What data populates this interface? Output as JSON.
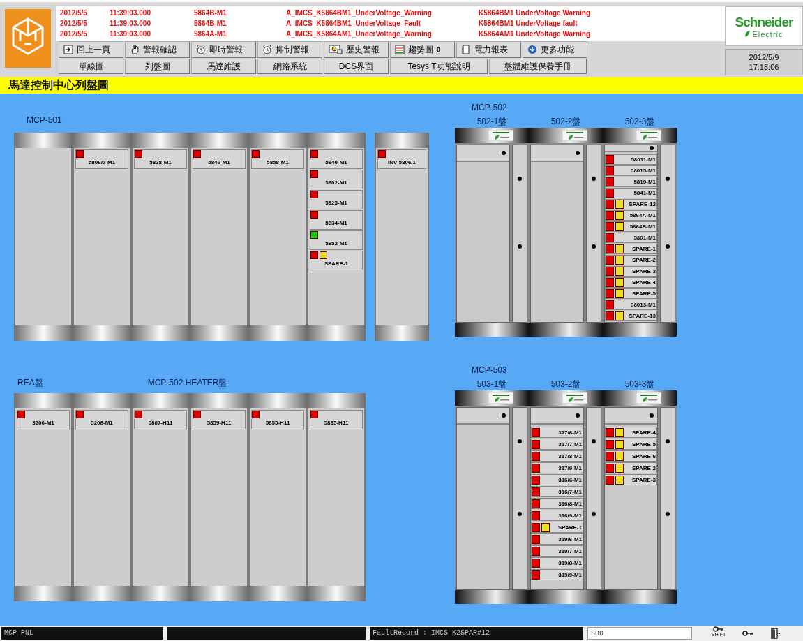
{
  "header": {
    "alarms": [
      {
        "date": "2012/5/5",
        "time": "11:39:03.000",
        "tag": "5864B-M1",
        "code": "A_IMCS_K5864BM1_UnderVoltage_Warning",
        "message": "K5864BM1 UnderVoltage Warning"
      },
      {
        "date": "2012/5/5",
        "time": "11:39:03.000",
        "tag": "5864B-M1",
        "code": "A_IMCS_K5864BM1_UnderVoltage_Fault",
        "message": "K5864BM1 UnderVoltage fault"
      },
      {
        "date": "2012/5/5",
        "time": "11:39:03.000",
        "tag": "5864A-M1",
        "code": "A_IMCS_K5864AM1_UnderVoltage_Warning",
        "message": "K5864AM1 UnderVoltage Warning"
      }
    ],
    "toolbar": [
      {
        "label": "回上一頁",
        "kind": "back"
      },
      {
        "label": "警報確認",
        "kind": "hand"
      },
      {
        "label": "即時警報",
        "kind": "alarm"
      },
      {
        "label": "抑制警報",
        "kind": "alarm"
      },
      {
        "label": "歷史警報",
        "kind": "history"
      },
      {
        "label": "趨勢圖",
        "kind": "trend",
        "count": "0"
      },
      {
        "label": "電力報表",
        "kind": "report"
      },
      {
        "label": "更多功能",
        "kind": "more"
      }
    ],
    "nav": [
      "單線圖",
      "列盤圖",
      "馬達維護",
      "網路系統",
      "DCS界面",
      "Tesys T功能說明",
      "盤體維護保養手冊"
    ],
    "brand": {
      "name": "Schneider",
      "sub": "Electric"
    },
    "clock": {
      "date": "2012/5/9",
      "time": "17:18:06"
    }
  },
  "title": "馬達控制中心列盤圖",
  "mcp501": {
    "label": "MCP-501",
    "columns": [
      {},
      {
        "units": [
          {
            "name": "5806/2-M1",
            "lamps": [
              {
                "color": "#e00000"
              }
            ]
          }
        ]
      },
      {
        "units": [
          {
            "name": "5828-M1",
            "lamps": [
              {
                "color": "#e00000"
              }
            ]
          }
        ]
      },
      {
        "units": [
          {
            "name": "5846-M1",
            "lamps": [
              {
                "color": "#e00000"
              }
            ]
          }
        ]
      },
      {
        "units": [
          {
            "name": "5858-M1",
            "lamps": [
              {
                "color": "#e00000"
              }
            ]
          }
        ]
      },
      {
        "units": [
          {
            "name": "5840-M1",
            "lamps": [
              {
                "color": "#e00000"
              }
            ]
          },
          {
            "name": "5802-M1",
            "lamps": [
              {
                "color": "#e00000"
              }
            ]
          },
          {
            "name": "5825-M1",
            "lamps": [
              {
                "color": "#e00000"
              }
            ]
          },
          {
            "name": "5834-M1",
            "lamps": [
              {
                "color": "#e00000"
              }
            ]
          },
          {
            "name": "5852-M1",
            "lamps": [
              {
                "color": "#10d010"
              }
            ]
          },
          {
            "name": "SPARE-1",
            "lamps": [
              {
                "color": "#e00000"
              },
              {
                "color": "#e8e020"
              }
            ]
          }
        ]
      }
    ],
    "inverter": {
      "units": [
        {
          "name": "INV-5806/1",
          "lamps": [
            {
              "color": "#e00000"
            }
          ]
        }
      ]
    }
  },
  "heater": {
    "labels": [
      "REA盤",
      "MCP-502 HEATER盤"
    ],
    "columns": [
      {
        "units": [
          {
            "name": "3206-M1",
            "lamps": [
              {
                "color": "#e00000"
              }
            ]
          }
        ]
      },
      {
        "units": [
          {
            "name": "5206-M1",
            "lamps": [
              {
                "color": "#e00000"
              }
            ]
          }
        ]
      },
      {
        "units": [
          {
            "name": "5867-H11",
            "lamps": [
              {
                "color": "#e00000"
              }
            ]
          }
        ]
      },
      {
        "units": [
          {
            "name": "5859-H11",
            "lamps": [
              {
                "color": "#e00000"
              }
            ]
          }
        ]
      },
      {
        "units": [
          {
            "name": "5855-H11",
            "lamps": [
              {
                "color": "#e00000"
              }
            ]
          }
        ]
      },
      {
        "units": [
          {
            "name": "5835-H11",
            "lamps": [
              {
                "color": "#e00000"
              }
            ]
          }
        ]
      }
    ]
  },
  "mcp502": {
    "label": "MCP-502",
    "panels": [
      {
        "label": "502-1盤"
      },
      {
        "label": "502-2盤"
      },
      {
        "label": "502-3盤",
        "units": [
          {
            "name": "58011-M1",
            "lamps": [
              {
                "color": "#e00000"
              }
            ]
          },
          {
            "name": "58015-M1",
            "lamps": [
              {
                "color": "#e00000"
              }
            ]
          },
          {
            "name": "5819-M1",
            "lamps": [
              {
                "color": "#e00000"
              }
            ]
          },
          {
            "name": "5841-M1",
            "lamps": [
              {
                "color": "#e00000"
              }
            ]
          },
          {
            "name": "SPARE-12",
            "lamps": [
              {
                "color": "#e00000"
              },
              {
                "color": "#e8e020"
              }
            ]
          },
          {
            "name": "5864A-M1",
            "lamps": [
              {
                "color": "#e00000"
              },
              {
                "color": "#e8e020"
              }
            ]
          },
          {
            "name": "5864B-M1",
            "lamps": [
              {
                "color": "#e00000"
              },
              {
                "color": "#e8e020"
              }
            ]
          },
          {
            "name": "5801-M1",
            "lamps": [
              {
                "color": "#e00000"
              }
            ]
          },
          {
            "name": "SPARE-1",
            "lamps": [
              {
                "color": "#e00000"
              },
              {
                "color": "#e8e020"
              }
            ]
          },
          {
            "name": "SPARE-2",
            "lamps": [
              {
                "color": "#e00000"
              },
              {
                "color": "#e8e020"
              }
            ]
          },
          {
            "name": "SPARE-3",
            "lamps": [
              {
                "color": "#e00000"
              },
              {
                "color": "#e8e020"
              }
            ]
          },
          {
            "name": "SPARE-4",
            "lamps": [
              {
                "color": "#e00000"
              },
              {
                "color": "#e8e020"
              }
            ]
          },
          {
            "name": "SPARE-5",
            "lamps": [
              {
                "color": "#e00000"
              },
              {
                "color": "#e8e020"
              }
            ]
          },
          {
            "name": "58013-M1",
            "lamps": [
              {
                "color": "#e00000"
              }
            ]
          },
          {
            "name": "SPARE-13",
            "lamps": [
              {
                "color": "#e00000"
              },
              {
                "color": "#e8e020"
              }
            ]
          }
        ]
      }
    ]
  },
  "mcp503": {
    "label": "MCP-503",
    "panels": [
      {
        "label": "503-1盤"
      },
      {
        "label": "503-2盤",
        "units": [
          {
            "name": "317/6-M1",
            "lamps": [
              {
                "color": "#e00000"
              }
            ]
          },
          {
            "name": "317/7-M1",
            "lamps": [
              {
                "color": "#e00000"
              }
            ]
          },
          {
            "name": "317/8-M1",
            "lamps": [
              {
                "color": "#e00000"
              }
            ]
          },
          {
            "name": "317/9-M1",
            "lamps": [
              {
                "color": "#e00000"
              }
            ]
          },
          {
            "name": "316/6-M1",
            "lamps": [
              {
                "color": "#e00000"
              }
            ]
          },
          {
            "name": "316/7-M1",
            "lamps": [
              {
                "color": "#e00000"
              }
            ]
          },
          {
            "name": "316/8-M1",
            "lamps": [
              {
                "color": "#e00000"
              }
            ]
          },
          {
            "name": "316/9-M1",
            "lamps": [
              {
                "color": "#e00000"
              }
            ]
          },
          {
            "name": "SPARE-1",
            "lamps": [
              {
                "color": "#e00000"
              },
              {
                "color": "#e8e020"
              }
            ]
          },
          {
            "name": "319/6-M1",
            "lamps": [
              {
                "color": "#e00000"
              }
            ]
          },
          {
            "name": "319/7-M1",
            "lamps": [
              {
                "color": "#e00000"
              }
            ]
          },
          {
            "name": "319/8-M1",
            "lamps": [
              {
                "color": "#e00000"
              }
            ]
          },
          {
            "name": "319/9-M1",
            "lamps": [
              {
                "color": "#e00000"
              }
            ]
          }
        ]
      },
      {
        "label": "503-3盤",
        "units": [
          {
            "name": "SPARE-4",
            "lamps": [
              {
                "color": "#e00000"
              },
              {
                "color": "#e8e020"
              }
            ]
          },
          {
            "name": "SPARE-5",
            "lamps": [
              {
                "color": "#e00000"
              },
              {
                "color": "#e8e020"
              }
            ]
          },
          {
            "name": "SPARE-6",
            "lamps": [
              {
                "color": "#e00000"
              },
              {
                "color": "#e8e020"
              }
            ]
          },
          {
            "name": "SPARE-2",
            "lamps": [
              {
                "color": "#e00000"
              },
              {
                "color": "#e8e020"
              }
            ]
          },
          {
            "name": "SPARE-3",
            "lamps": [
              {
                "color": "#e00000"
              },
              {
                "color": "#e8e020"
              }
            ]
          }
        ]
      }
    ]
  },
  "status_bar": {
    "panel": "MCP_PNL",
    "record": "FaultRecord : IMCS_K2SPAR#12",
    "user": "SDD",
    "shift": "SHIFT"
  }
}
